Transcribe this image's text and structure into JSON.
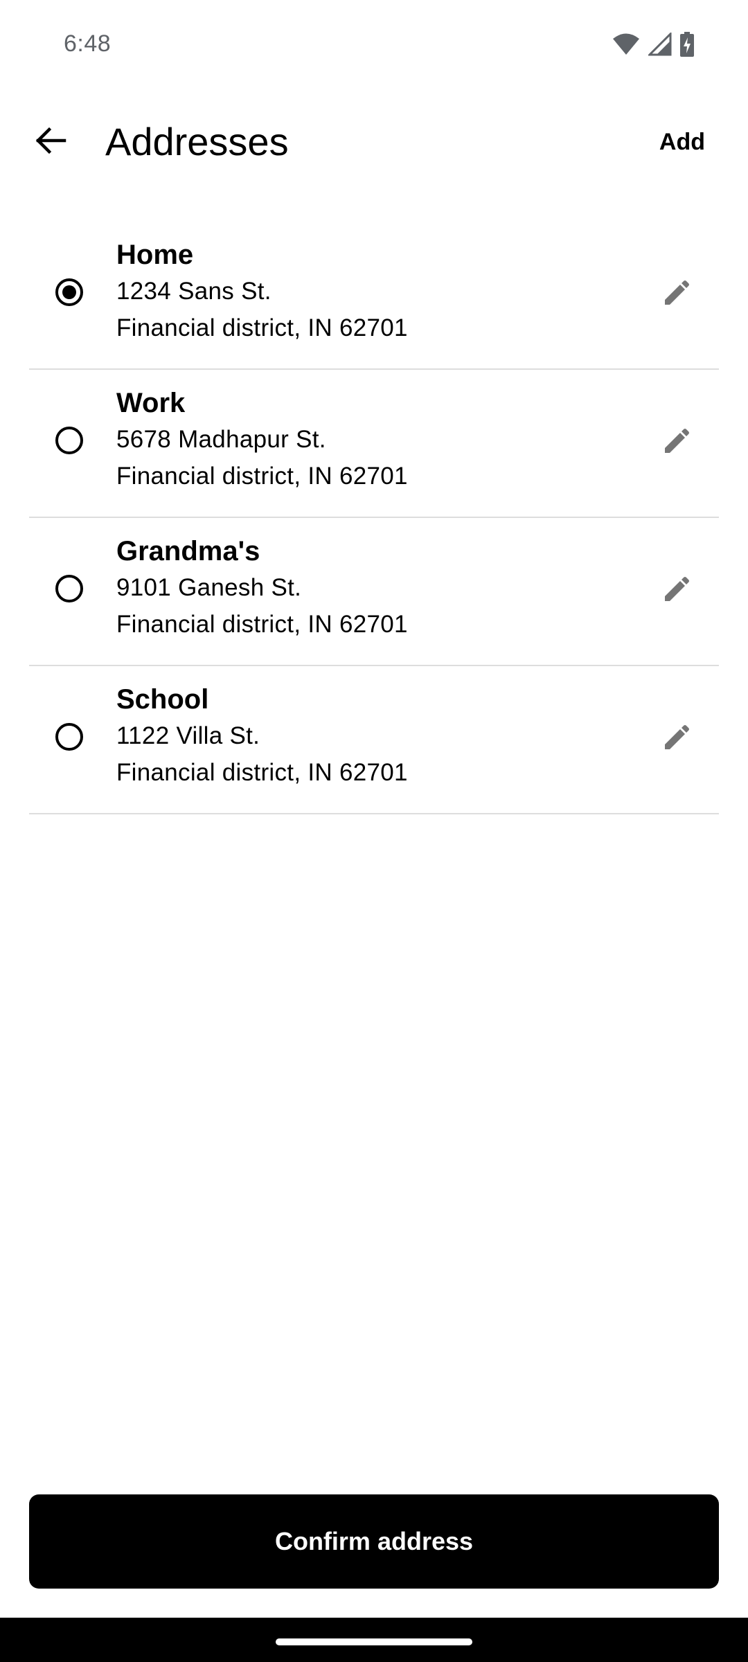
{
  "status_bar": {
    "time": "6:48",
    "icons": [
      "wifi-icon",
      "cellular-signal-icon",
      "battery-charging-icon"
    ]
  },
  "app_bar": {
    "back_icon": "arrow-back-icon",
    "title": "Addresses",
    "add_label": "Add"
  },
  "addresses": [
    {
      "name": "Home",
      "line1": "1234 Sans St.",
      "line2": "Financial district, IN 62701",
      "selected": true
    },
    {
      "name": "Work",
      "line1": "5678 Madhapur St.",
      "line2": "Financial district, IN 62701",
      "selected": false
    },
    {
      "name": "Grandma's",
      "line1": "9101 Ganesh St.",
      "line2": "Financial district, IN 62701",
      "selected": false
    },
    {
      "name": "School",
      "line1": "1122 Villa St.",
      "line2": "Financial district, IN 62701",
      "selected": false
    }
  ],
  "edit_icon": "pencil-edit-icon",
  "confirm_label": "Confirm address",
  "colors": {
    "accent": "#000000",
    "background": "#ffffff",
    "divider": "#dddddd",
    "edit_icon": "#757575",
    "status_text": "#5f6368"
  }
}
